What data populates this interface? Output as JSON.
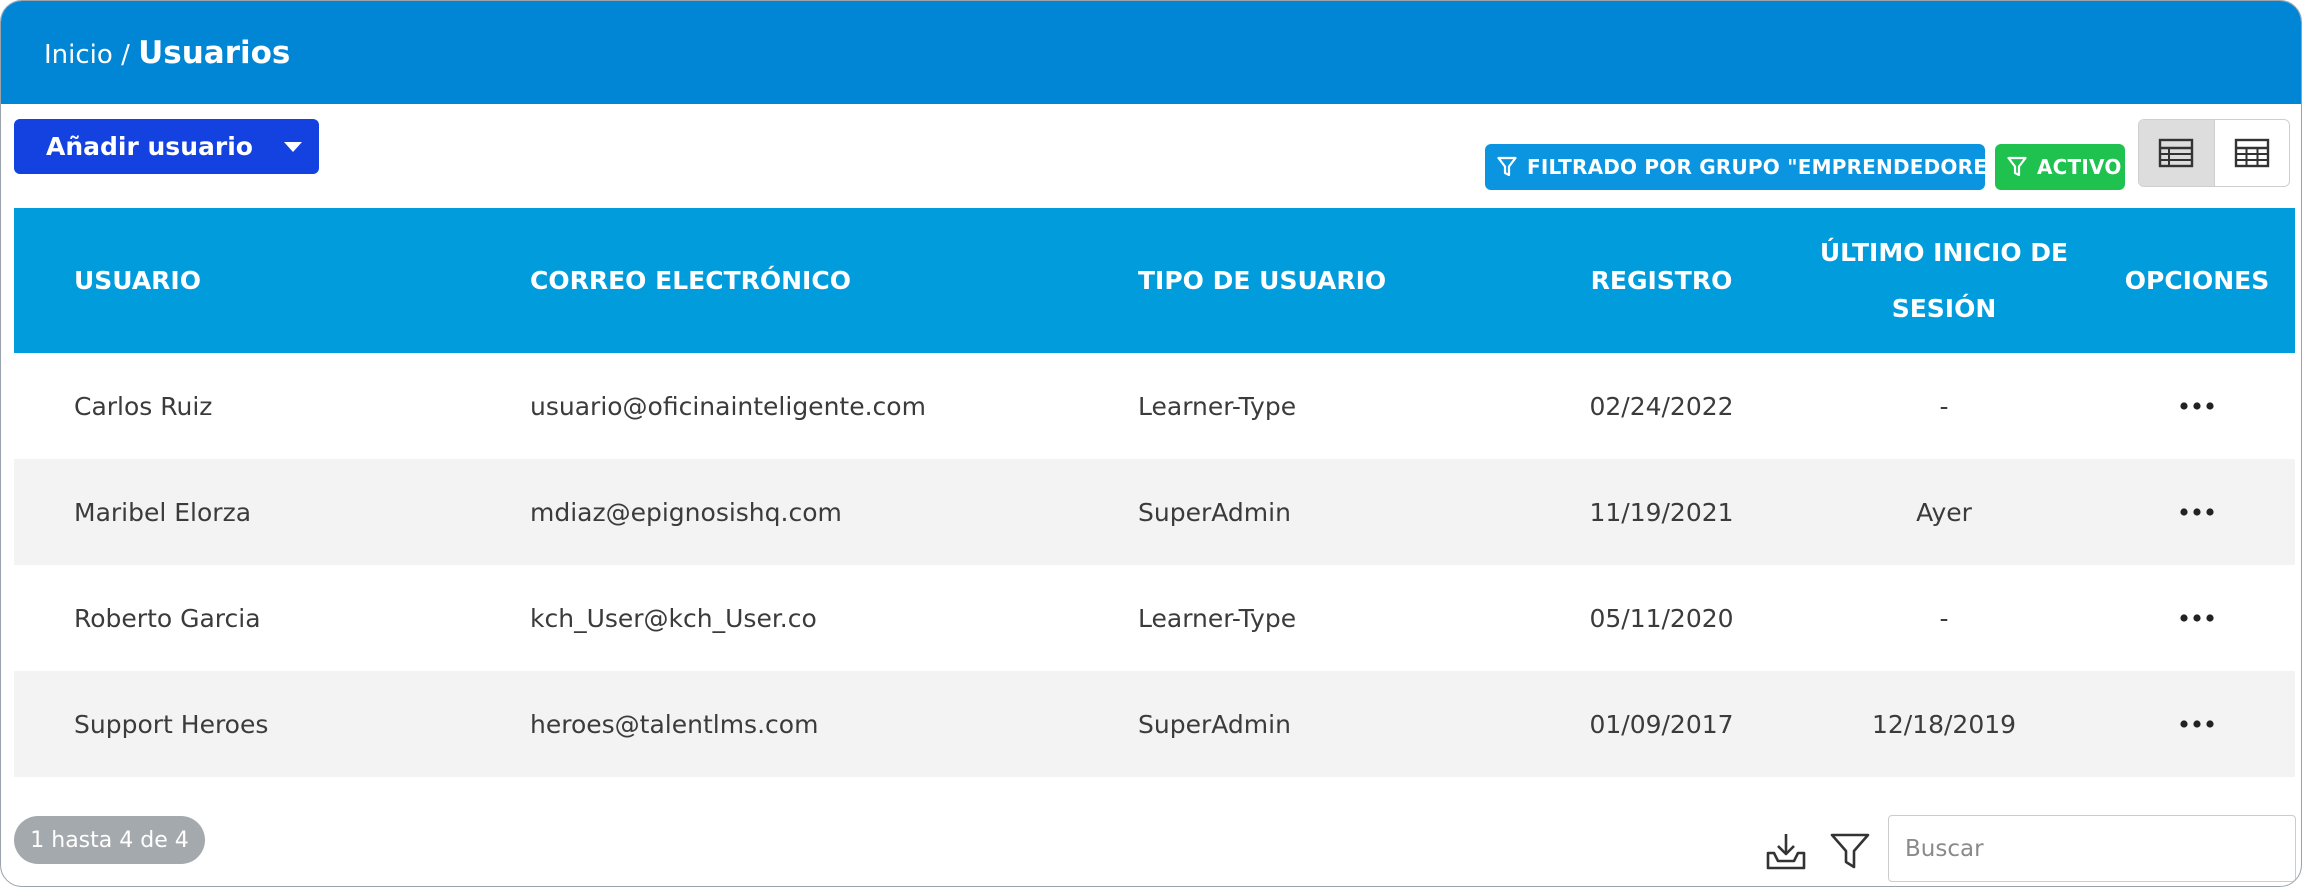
{
  "breadcrumb": {
    "home": "Inicio",
    "separator": "/",
    "current": "Usuarios"
  },
  "toolbar": {
    "add_user_label": "Añadir usuario",
    "filter_group_label": "FILTRADO POR GRUPO \"EMPRENDEDORES\"",
    "filter_active_label": "ACTIVO",
    "view_modes": [
      {
        "icon": "list-view-icon",
        "selected": true
      },
      {
        "icon": "grid-view-icon",
        "selected": false
      }
    ]
  },
  "table": {
    "columns": {
      "user": "USUARIO",
      "email": "CORREO ELECTRÓNICO",
      "type": "TIPO DE USUARIO",
      "registered": "REGISTRO",
      "last_login_line1": "ÚLTIMO INICIO DE",
      "last_login_line2": "SESIÓN",
      "options": "OPCIONES"
    },
    "rows": [
      {
        "user": "Carlos Ruiz",
        "email": "usuario@oficinainteligente.com",
        "type": "Learner-Type",
        "registered": "02/24/2022",
        "last_login": "-"
      },
      {
        "user": "Maribel Elorza",
        "email": "mdiaz@epignosishq.com",
        "type": "SuperAdmin",
        "registered": "11/19/2021",
        "last_login": "Ayer"
      },
      {
        "user": "Roberto Garcia",
        "email": "kch_User@kch_User.co",
        "type": "Learner-Type",
        "registered": "05/11/2020",
        "last_login": "-"
      },
      {
        "user": "Support Heroes",
        "email": "heroes@talentlms.com",
        "type": "SuperAdmin",
        "registered": "01/09/2017",
        "last_login": "12/18/2019"
      }
    ]
  },
  "footer": {
    "count_label": "1 hasta 4 de 4",
    "search_placeholder": "Buscar"
  },
  "colors": {
    "header_bg": "#0186d6",
    "table_header_bg": "#019cdc",
    "primary_button": "#1442e0",
    "filter_pill": "#0b95e0",
    "active_pill": "#1fc14f",
    "count_badge": "#a4a9ad"
  }
}
